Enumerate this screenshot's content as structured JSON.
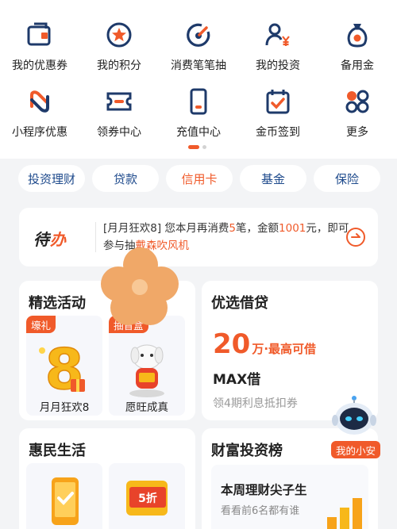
{
  "quick_grid": [
    {
      "label": "我的优惠券",
      "icon": "coupon-wallet-icon"
    },
    {
      "label": "我的积分",
      "icon": "star-points-icon"
    },
    {
      "label": "消费笔笔抽",
      "icon": "lottery-dial-icon"
    },
    {
      "label": "我的投资",
      "icon": "person-yen-icon"
    },
    {
      "label": "备用金",
      "icon": "money-bag-icon"
    },
    {
      "label": "小程序优惠",
      "icon": "mini-program-icon"
    },
    {
      "label": "领券中心",
      "icon": "ticket-icon"
    },
    {
      "label": "充值中心",
      "icon": "phone-topup-icon"
    },
    {
      "label": "金币签到",
      "icon": "checkin-calendar-icon"
    },
    {
      "label": "更多",
      "icon": "more-grid-icon"
    }
  ],
  "tabs": [
    "投资理财",
    "贷款",
    "信用卡",
    "基金",
    "保险"
  ],
  "active_tab": "信用卡",
  "todo": {
    "badge_a": "待",
    "badge_b": "办",
    "text_1": "[月月狂欢8] 您本月再消费",
    "count": "5",
    "text_2": "笔，金额",
    "amount": "1001",
    "text_3": "元，即可参与抽",
    "prize": "戴森吹风机"
  },
  "featured": {
    "title": "精选活动",
    "items": [
      {
        "tag": "壕礼",
        "label": "月月狂欢8",
        "art_text": "8"
      },
      {
        "tag": "抽盲盒",
        "label": "愿旺成真"
      }
    ]
  },
  "loan": {
    "title": "优选借贷",
    "amount": "20",
    "amount_suffix": "万·最高可借",
    "name": "MAX借",
    "sub": "领4期利息抵扣券"
  },
  "robot": {
    "label": "我的小安"
  },
  "life": {
    "title": "惠民生活",
    "coupon_text": "5折"
  },
  "wealth": {
    "title": "财富投资榜",
    "inner_title": "本周理财尖子生",
    "inner_sub": "看看前6名都有谁"
  },
  "colors": {
    "accent": "#f05a2a",
    "navy": "#1e4a8c",
    "overlay_flower": "#f0a868"
  }
}
